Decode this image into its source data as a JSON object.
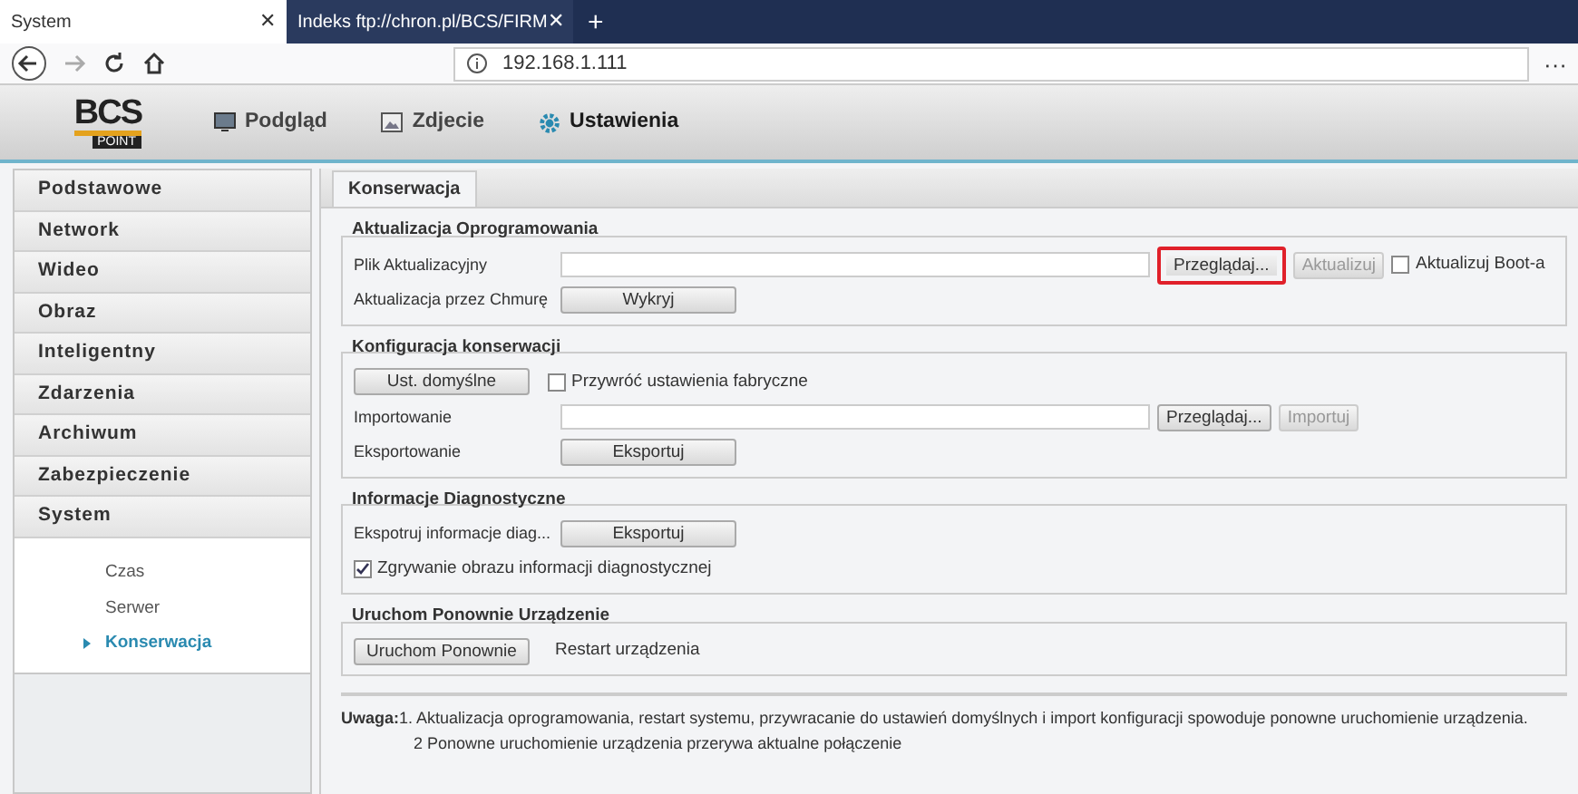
{
  "browser": {
    "tabs": [
      {
        "title": "System",
        "selected": true,
        "close": "✕"
      },
      {
        "title": "Indeks ftp://chron.pl/BCS/FIRM",
        "selected": false,
        "close": "✕"
      }
    ],
    "new_tab": "+",
    "address": "192.168.1.111",
    "menu": "···"
  },
  "app": {
    "logo": {
      "main": "BCS",
      "sub": "POINT"
    },
    "nav": [
      {
        "label": "Podgląd",
        "selected": false
      },
      {
        "label": "Zdjecie",
        "selected": false
      },
      {
        "label": "Ustawienia",
        "selected": true
      }
    ]
  },
  "sidebar": {
    "items": [
      {
        "label": "Podstawowe",
        "expanded": false
      },
      {
        "label": "Network",
        "expanded": false
      },
      {
        "label": "Wideo",
        "expanded": false
      },
      {
        "label": "Obraz",
        "expanded": false
      },
      {
        "label": "Inteligentny",
        "expanded": false
      },
      {
        "label": "Zdarzenia",
        "expanded": false
      },
      {
        "label": "Archiwum",
        "expanded": false
      },
      {
        "label": "Zabezpieczenie",
        "expanded": false
      },
      {
        "label": "System",
        "expanded": true,
        "children": [
          {
            "label": "Czas",
            "selected": false
          },
          {
            "label": "Serwer",
            "selected": false
          },
          {
            "label": "Konserwacja",
            "selected": true
          }
        ]
      }
    ]
  },
  "tabs": [
    {
      "label": "Konserwacja",
      "selected": true
    }
  ],
  "sections": [
    {
      "title": "Aktualizacja Oprogramowania",
      "rows": [
        [
          {
            "kind": "label",
            "text": "Plik Aktualizacyjny"
          },
          {
            "kind": "input"
          },
          {
            "kind": "button",
            "text": "Przeglądaj...",
            "disabled": false,
            "highlighted": true
          },
          {
            "kind": "button",
            "text": "Aktualizuj",
            "disabled": true,
            "highlighted": false
          },
          {
            "kind": "checkbox",
            "text": "Aktualizuj Boot-a",
            "checked": false
          }
        ],
        [
          {
            "kind": "label",
            "text": "Aktualizacja przez Chmurę"
          },
          {
            "kind": "widebutton",
            "text": "Wykryj",
            "disabled": false,
            "highlighted": false
          }
        ]
      ]
    },
    {
      "title": "Konfiguracja konserwacji",
      "rows": [
        [
          {
            "kind": "widebutton",
            "text": "Ust. domyślne",
            "disabled": false,
            "highlighted": false
          },
          {
            "kind": "checkbox",
            "text": "Przywróć ustawienia fabryczne",
            "checked": false
          }
        ],
        [
          {
            "kind": "label",
            "text": "Importowanie"
          },
          {
            "kind": "input"
          },
          {
            "kind": "button",
            "text": "Przeglądaj...",
            "disabled": false,
            "highlighted": false
          },
          {
            "kind": "button",
            "text": "Importuj",
            "disabled": true,
            "highlighted": false
          }
        ],
        [
          {
            "kind": "label",
            "text": "Eksportowanie"
          },
          {
            "kind": "widebutton",
            "text": "Eksportuj",
            "disabled": false,
            "highlighted": false
          }
        ]
      ]
    },
    {
      "title": "Informacje Diagnostyczne",
      "rows": [
        [
          {
            "kind": "label",
            "text": "Ekspotruj informacje diag..."
          },
          {
            "kind": "widebutton",
            "text": "Eksportuj",
            "disabled": false,
            "highlighted": false
          }
        ],
        [
          {
            "kind": "checkbox",
            "text": "Zgrywanie obrazu informacji diagnostycznej",
            "checked": true
          }
        ]
      ]
    },
    {
      "title": "Uruchom Ponownie Urządzenie",
      "rows": [
        [
          {
            "kind": "widebutton",
            "text": "Uruchom Ponownie",
            "disabled": false,
            "highlighted": false
          },
          {
            "kind": "text",
            "text": "Restart urządzenia"
          }
        ]
      ]
    }
  ],
  "note": {
    "title": "Uwaga:",
    "lines": [
      "1. Aktualizacja oprogramowania, restart systemu, przywracanie do ustawień domyślnych i import konfiguracji spowoduje ponowne uruchomienie urządzenia.",
      "2 Ponowne uruchomienie urządzenia przerywa aktualne połączenie"
    ]
  }
}
